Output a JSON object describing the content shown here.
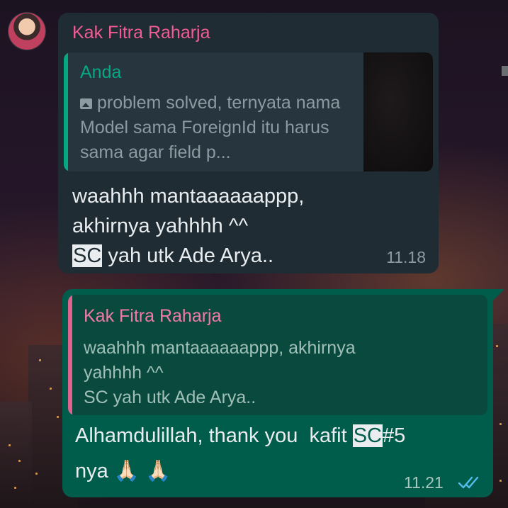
{
  "incoming": {
    "sender": "Kak Fitra Raharja",
    "quote": {
      "author": "Anda",
      "icon": "image-icon",
      "text": "problem solved, ternyata nama Model sama ForeignId itu harus sama agar field p..."
    },
    "text_line1": "waahhh mantaaaaaappp,",
    "text_line2": "akhirnya yahhhh ^^",
    "text_highlight": "SC",
    "text_line3_rest": " yah utk Ade Arya..",
    "time": "11.18"
  },
  "outgoing": {
    "quote": {
      "author": "Kak Fitra Raharja",
      "text_line1": "waahhh mantaaaaaappp, akhirnya",
      "text_line2": "yahhhh ^^",
      "text_line3": "SC yah utk Ade Arya.."
    },
    "text_prefix": "Alhamdulillah, thank you  kafit ",
    "text_highlight": "SC",
    "text_suffix": "#5",
    "text_line2": "nya 🙏🏻 🙏🏻",
    "time": "11.21",
    "status_icon": "double-check-icon",
    "status_color": "#53bdeb"
  },
  "colors": {
    "incoming_bubble": "#1f2c34",
    "outgoing_bubble": "#005c4b",
    "sender_name": "#f25c95",
    "quote_author_green": "#06a884"
  }
}
